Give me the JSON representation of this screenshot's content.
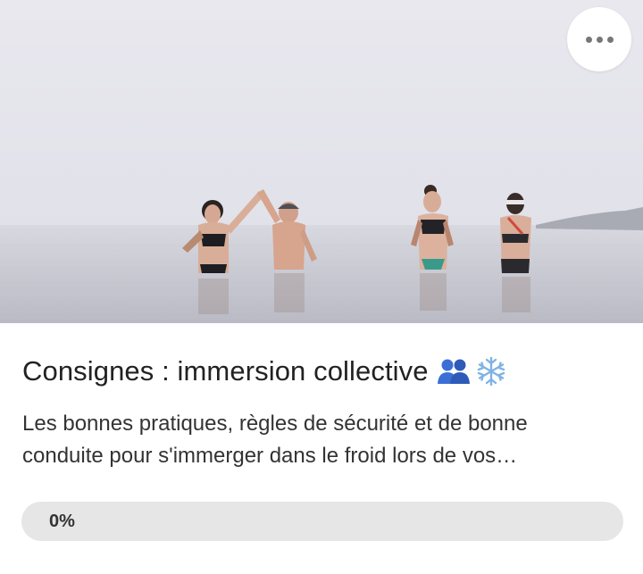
{
  "card": {
    "title": "Consignes : immersion collective",
    "title_icons": [
      "people-icon",
      "snowflake-icon"
    ],
    "description": "Les bonnes pratiques, règles de sécurité et de bonne conduite pour s'immerger dans le froid lors de vos…",
    "progress": {
      "label": "0%",
      "value": 0
    },
    "menu_icon": "more-horizontal-icon"
  },
  "colors": {
    "people_icon": "#3b6fd6",
    "snowflake_icon": "#7fb3e6",
    "progress_track": "#e6e6e6"
  }
}
